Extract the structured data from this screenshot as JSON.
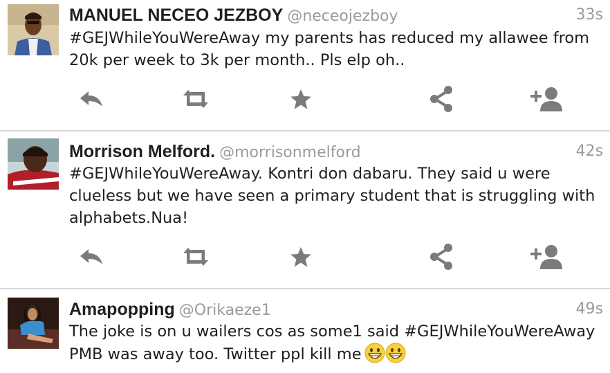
{
  "tweets": [
    {
      "name": "MANUEL NECEO JEZBOY",
      "handle": "@neceojezboy",
      "time": "33s",
      "text": "#GEJWhileYouWereAway my parents has reduced my allawee from 20k per week to 3k per month.. Pls elp oh.."
    },
    {
      "name": "Morrison Melford.",
      "handle": "@morrisonmelford",
      "time": "42s",
      "text": "#GEJWhileYouWereAway. Kontri don dabaru. They said u were clueless but we have seen a primary student that is struggling with alphabets.Nua!"
    },
    {
      "name": "Amapopping",
      "handle": "@Orikaeze1",
      "time": "49s",
      "text": "The joke is on u wailers cos as some1 said #GEJWhileYouWereAway PMB was away too. Twitter ppl kill me",
      "emoji": [
        "grinning-face-emoji",
        "grinning-face-emoji"
      ]
    }
  ],
  "action_icons": [
    "reply-icon",
    "retweet-icon",
    "favorite-star-icon",
    "share-icon",
    "follow-add-user-icon"
  ],
  "colors": {
    "icon_gray": "#7b7b7b",
    "meta_gray": "#9a9a9a",
    "text": "#1f1f1f",
    "divider": "#d8d8d8",
    "emoji_yellow": "#f7d13b"
  }
}
